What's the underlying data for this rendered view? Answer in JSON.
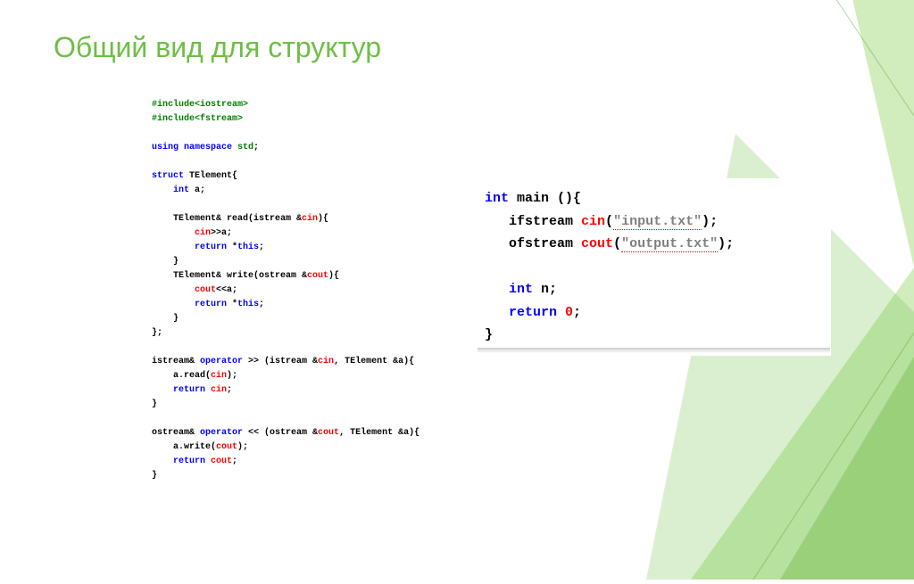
{
  "title": "Общий вид для структур",
  "colors": {
    "accent": "#6DBE45",
    "green": "#008000",
    "blue": "#0000ff",
    "red": "#ff0000",
    "gray": "#808080"
  },
  "code_left": {
    "lines": [
      {
        "segments": [
          {
            "t": "#include<iostream>",
            "cls": "c-green"
          }
        ]
      },
      {
        "segments": [
          {
            "t": "#include<fstream>",
            "cls": "c-green"
          }
        ]
      },
      {
        "segments": [
          {
            "t": " ",
            "cls": ""
          }
        ]
      },
      {
        "segments": [
          {
            "t": "using namespace ",
            "cls": "c-blue"
          },
          {
            "t": "std",
            "cls": "c-green"
          },
          {
            "t": ";",
            "cls": ""
          }
        ]
      },
      {
        "segments": [
          {
            "t": " ",
            "cls": ""
          }
        ]
      },
      {
        "segments": [
          {
            "t": "struct ",
            "cls": "c-blue"
          },
          {
            "t": "TElement{",
            "cls": ""
          }
        ]
      },
      {
        "segments": [
          {
            "t": "    int ",
            "cls": "c-blue"
          },
          {
            "t": "a;",
            "cls": ""
          }
        ]
      },
      {
        "segments": [
          {
            "t": " ",
            "cls": ""
          }
        ]
      },
      {
        "segments": [
          {
            "t": "    TElement& read(istream &",
            "cls": ""
          },
          {
            "t": "cin",
            "cls": "c-red"
          },
          {
            "t": "){",
            "cls": ""
          }
        ]
      },
      {
        "segments": [
          {
            "t": "        cin",
            "cls": "c-red"
          },
          {
            "t": ">>a;",
            "cls": ""
          }
        ]
      },
      {
        "segments": [
          {
            "t": "        return ",
            "cls": "c-blue"
          },
          {
            "t": "*",
            "cls": ""
          },
          {
            "t": "this",
            "cls": "c-blue"
          },
          {
            "t": ";",
            "cls": ""
          }
        ]
      },
      {
        "segments": [
          {
            "t": "    }",
            "cls": ""
          }
        ]
      },
      {
        "segments": [
          {
            "t": "    TElement& write(ostream &",
            "cls": ""
          },
          {
            "t": "cout",
            "cls": "c-red"
          },
          {
            "t": "){",
            "cls": ""
          }
        ]
      },
      {
        "segments": [
          {
            "t": "        cout",
            "cls": "c-red"
          },
          {
            "t": "<<a;",
            "cls": ""
          }
        ]
      },
      {
        "segments": [
          {
            "t": "        return ",
            "cls": "c-blue"
          },
          {
            "t": "*",
            "cls": ""
          },
          {
            "t": "this",
            "cls": "c-blue"
          },
          {
            "t": ";",
            "cls": ""
          }
        ]
      },
      {
        "segments": [
          {
            "t": "    }",
            "cls": ""
          }
        ]
      },
      {
        "segments": [
          {
            "t": "};",
            "cls": ""
          }
        ]
      },
      {
        "segments": [
          {
            "t": " ",
            "cls": ""
          }
        ]
      },
      {
        "segments": [
          {
            "t": "istream& ",
            "cls": ""
          },
          {
            "t": "operator ",
            "cls": "c-blue"
          },
          {
            "t": ">> (istream &",
            "cls": ""
          },
          {
            "t": "cin",
            "cls": "c-red"
          },
          {
            "t": ", TElement &a){",
            "cls": ""
          }
        ]
      },
      {
        "segments": [
          {
            "t": "    a.read(",
            "cls": ""
          },
          {
            "t": "cin",
            "cls": "c-red"
          },
          {
            "t": ");",
            "cls": ""
          }
        ]
      },
      {
        "segments": [
          {
            "t": "    return ",
            "cls": "c-blue"
          },
          {
            "t": "cin",
            "cls": "c-red"
          },
          {
            "t": ";",
            "cls": ""
          }
        ]
      },
      {
        "segments": [
          {
            "t": "}",
            "cls": ""
          }
        ]
      },
      {
        "segments": [
          {
            "t": " ",
            "cls": ""
          }
        ]
      },
      {
        "segments": [
          {
            "t": "ostream& ",
            "cls": ""
          },
          {
            "t": "operator ",
            "cls": "c-blue"
          },
          {
            "t": "<< (ostream &",
            "cls": ""
          },
          {
            "t": "cout",
            "cls": "c-red"
          },
          {
            "t": ", TElement &a){",
            "cls": ""
          }
        ]
      },
      {
        "segments": [
          {
            "t": "    a.write(",
            "cls": ""
          },
          {
            "t": "cout",
            "cls": "c-red"
          },
          {
            "t": ");",
            "cls": ""
          }
        ]
      },
      {
        "segments": [
          {
            "t": "    return ",
            "cls": "c-blue"
          },
          {
            "t": "cout",
            "cls": "c-red"
          },
          {
            "t": ";",
            "cls": ""
          }
        ]
      },
      {
        "segments": [
          {
            "t": "}",
            "cls": ""
          }
        ]
      }
    ]
  },
  "code_right": {
    "lines": [
      {
        "segments": [
          {
            "t": "int ",
            "cls": "kw"
          },
          {
            "t": "main (){",
            "cls": ""
          }
        ]
      },
      {
        "segments": [
          {
            "t": "   ifstream ",
            "cls": ""
          },
          {
            "t": "cin",
            "cls": "c-red"
          },
          {
            "t": "(",
            "cls": ""
          },
          {
            "t": "\"input.txt\"",
            "cls": "str"
          },
          {
            "t": ");",
            "cls": ""
          }
        ]
      },
      {
        "segments": [
          {
            "t": "   ofstream ",
            "cls": ""
          },
          {
            "t": "cout",
            "cls": "c-red"
          },
          {
            "t": "(",
            "cls": ""
          },
          {
            "t": "\"output.txt\"",
            "cls": "str"
          },
          {
            "t": ");",
            "cls": ""
          }
        ]
      },
      {
        "segments": [
          {
            "t": " ",
            "cls": ""
          }
        ]
      },
      {
        "segments": [
          {
            "t": "   int ",
            "cls": "kw"
          },
          {
            "t": "n;",
            "cls": ""
          }
        ]
      },
      {
        "segments": [
          {
            "t": "   return ",
            "cls": "kw"
          },
          {
            "t": "0",
            "cls": "num"
          },
          {
            "t": ";",
            "cls": ""
          }
        ]
      },
      {
        "segments": [
          {
            "t": "}",
            "cls": ""
          }
        ]
      }
    ]
  }
}
